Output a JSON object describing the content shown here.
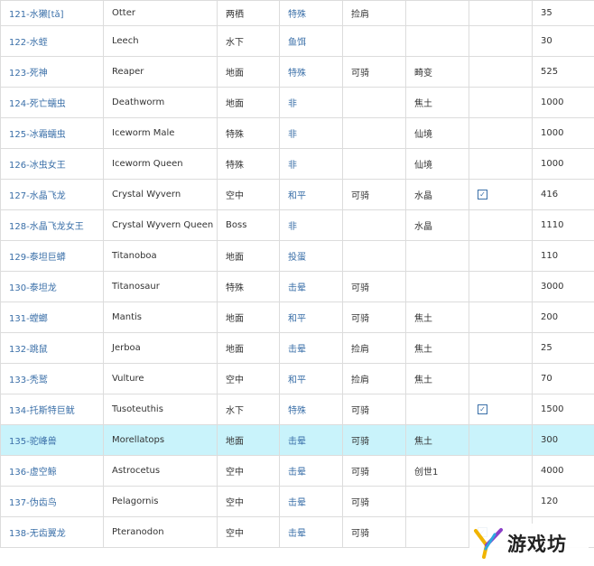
{
  "rows": [
    {
      "name": "121-水獭[tǎ]",
      "en": "Otter",
      "habitat": "两栖",
      "temper": "特殊",
      "c4": "捡肩",
      "c5": "",
      "check": false,
      "value": "35"
    },
    {
      "name": "122-水蛭",
      "en": "Leech",
      "habitat": "水下",
      "temper": "鱼饵",
      "c4": "",
      "c5": "",
      "check": false,
      "value": "30"
    },
    {
      "name": "123-死神",
      "en": "Reaper",
      "habitat": "地面",
      "temper": "特殊",
      "c4": "可骑",
      "c5": "畸变",
      "check": false,
      "value": "525"
    },
    {
      "name": "124-死亡蠕虫",
      "en": "Deathworm",
      "habitat": "地面",
      "temper": "非",
      "c4": "",
      "c5": "焦土",
      "check": false,
      "value": "1000"
    },
    {
      "name": "125-冰霜蠕虫",
      "en": "Iceworm Male",
      "habitat": "特殊",
      "temper": "非",
      "c4": "",
      "c5": "仙境",
      "check": false,
      "value": "1000"
    },
    {
      "name": "126-冰虫女王",
      "en": "Iceworm Queen",
      "habitat": "特殊",
      "temper": "非",
      "c4": "",
      "c5": "仙境",
      "check": false,
      "value": "1000"
    },
    {
      "name": "127-水晶飞龙",
      "en": "Crystal Wyvern",
      "habitat": "空中",
      "temper": "和平",
      "c4": "可骑",
      "c5": "水晶",
      "check": true,
      "value": "416"
    },
    {
      "name": "128-水晶飞龙女王",
      "en": "Crystal Wyvern Queen",
      "habitat": "Boss",
      "temper": "非",
      "c4": "",
      "c5": "水晶",
      "check": false,
      "value": "1110"
    },
    {
      "name": "129-泰坦巨蟒",
      "en": "Titanoboa",
      "habitat": "地面",
      "temper": "投蛋",
      "c4": "",
      "c5": "",
      "check": false,
      "value": "110"
    },
    {
      "name": "130-泰坦龙",
      "en": "Titanosaur",
      "habitat": "特殊",
      "temper": "击晕",
      "c4": "可骑",
      "c5": "",
      "check": false,
      "value": "3000"
    },
    {
      "name": "131-螳螂",
      "en": "Mantis",
      "habitat": "地面",
      "temper": "和平",
      "c4": "可骑",
      "c5": "焦土",
      "check": false,
      "value": "200"
    },
    {
      "name": "132-跳鼠",
      "en": "Jerboa",
      "habitat": "地面",
      "temper": "击晕",
      "c4": "捡肩",
      "c5": "焦土",
      "check": false,
      "value": "25"
    },
    {
      "name": "133-秃鹫",
      "en": "Vulture",
      "habitat": "空中",
      "temper": "和平",
      "c4": "捡肩",
      "c5": "焦土",
      "check": false,
      "value": "70"
    },
    {
      "name": "134-托斯特巨鱿",
      "en": "Tusoteuthis",
      "habitat": "水下",
      "temper": "特殊",
      "c4": "可骑",
      "c5": "",
      "check": true,
      "value": "1500"
    },
    {
      "name": "135-驼峰兽",
      "en": "Morellatops",
      "habitat": "地面",
      "temper": "击晕",
      "c4": "可骑",
      "c5": "焦土",
      "check": false,
      "value": "300"
    },
    {
      "name": "136-虚空鲸",
      "en": "Astrocetus",
      "habitat": "空中",
      "temper": "击晕",
      "c4": "可骑",
      "c5": "创世1",
      "check": false,
      "value": "4000"
    },
    {
      "name": "137-伪齿鸟",
      "en": "Pelagornis",
      "habitat": "空中",
      "temper": "击晕",
      "c4": "可骑",
      "c5": "",
      "check": false,
      "value": "120"
    },
    {
      "name": "138-无齿翼龙",
      "en": "Pteranodon",
      "habitat": "空中",
      "temper": "击晕",
      "c4": "可骑",
      "c5": "",
      "check": true,
      "value": ""
    }
  ],
  "highlight_row": 14,
  "watermark": {
    "text": "游戏坊",
    "icon": "y-logo-icon"
  },
  "colors": {
    "link": "#3a6fa8",
    "highlight": "#c9f3fb",
    "border": "#dcdcdc"
  }
}
